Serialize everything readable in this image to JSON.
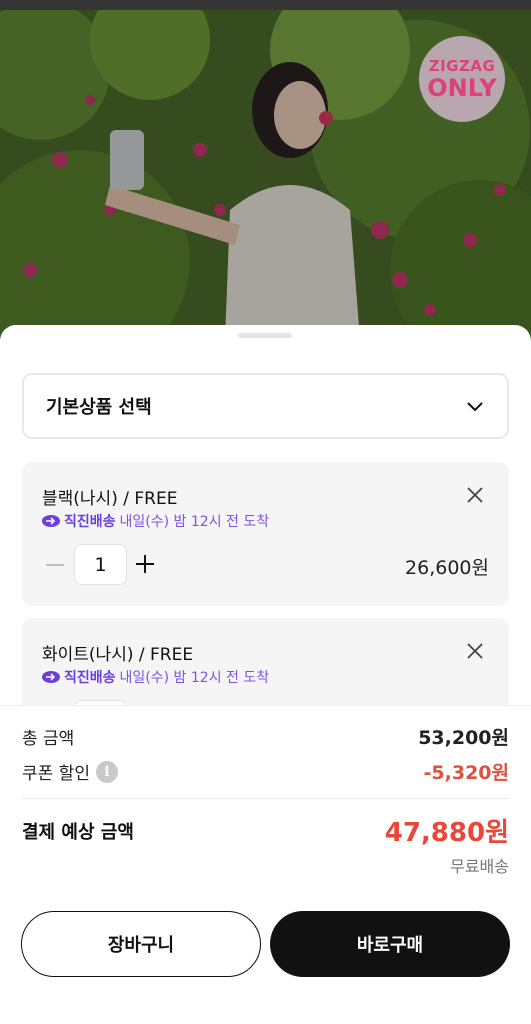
{
  "badge": {
    "line1": "ZIGZAG",
    "line2": "ONLY"
  },
  "selector": {
    "label": "기본상품 선택",
    "icon": "chevron-down-icon"
  },
  "options": [
    {
      "name": "블랙(나시) / FREE",
      "shipping_brand": "직진배송",
      "shipping_date": "내일(수) 밤 12시 전 도착",
      "quantity": "1",
      "price": "26,600원"
    },
    {
      "name": "화이트(나시) / FREE",
      "shipping_brand": "직진배송",
      "shipping_date": "내일(수) 밤 12시 전 도착"
    }
  ],
  "summary": {
    "total_label": "총 금액",
    "total_value": "53,200원",
    "coupon_label": "쿠폰 할인",
    "coupon_value": "-5,320원",
    "pay_label": "결제 예상 금액",
    "pay_value": "47,880원",
    "shipping_note": "무료배송"
  },
  "buttons": {
    "cart": "장바구니",
    "buy": "바로구매"
  },
  "colors": {
    "accent_purple": "#6a3fdc",
    "price_red": "#e8473a",
    "zigzag_pink": "#e0407a"
  }
}
